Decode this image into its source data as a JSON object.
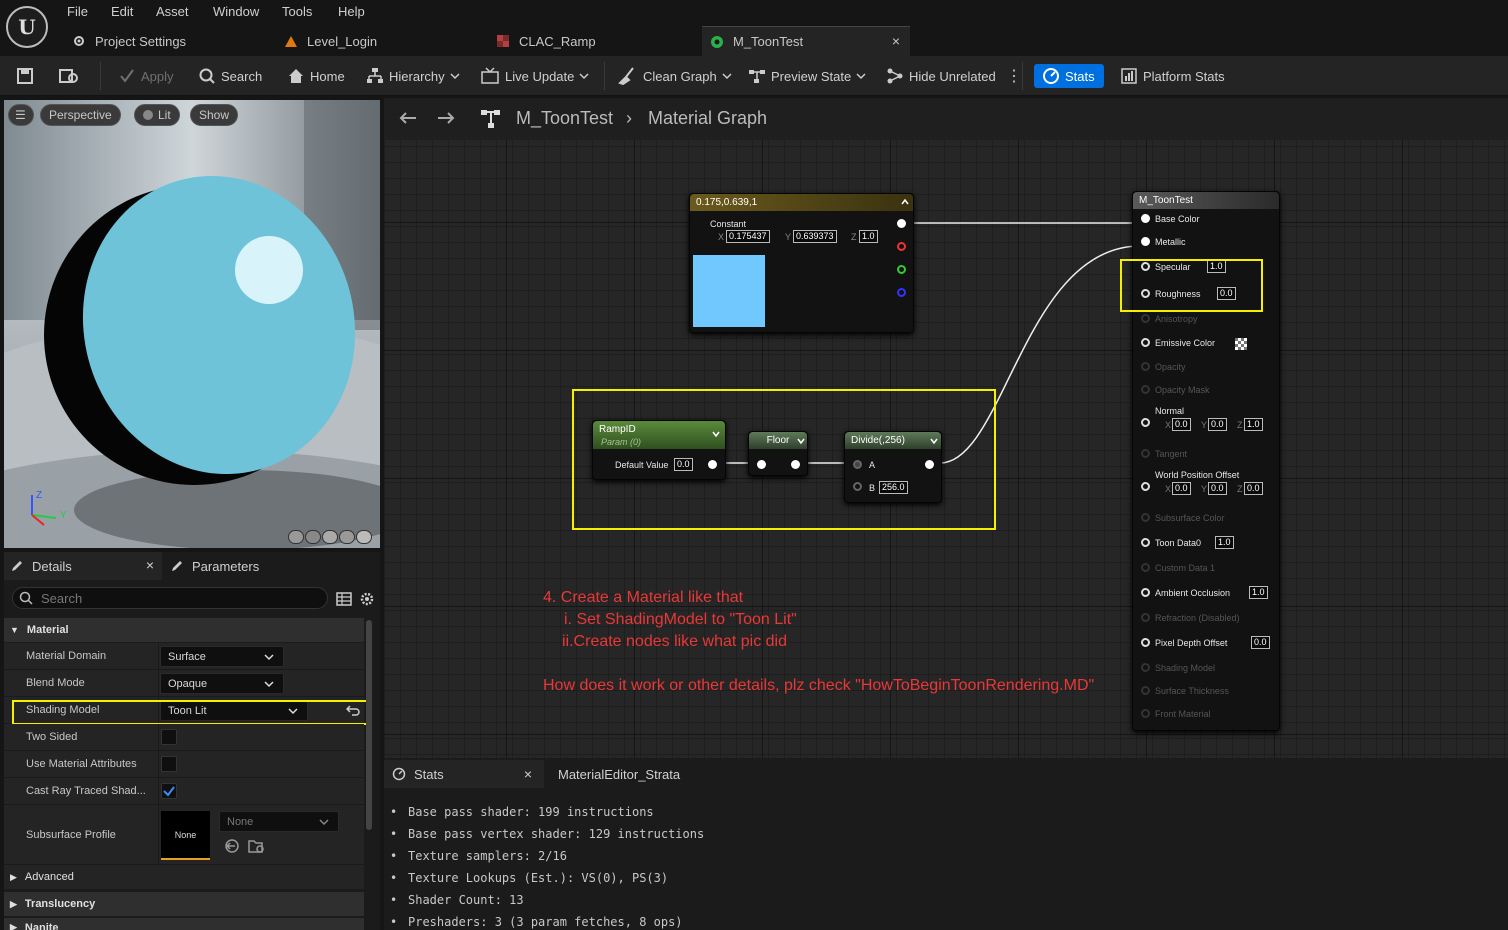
{
  "menu": [
    "File",
    "Edit",
    "Asset",
    "Window",
    "Tools",
    "Help"
  ],
  "tabs": [
    {
      "label": "Project Settings",
      "icon": "gear-icon"
    },
    {
      "label": "Level_Login",
      "icon": "level-icon"
    },
    {
      "label": "CLAC_Ramp",
      "icon": "texture-icon"
    },
    {
      "label": "M_ToonTest",
      "icon": "material-icon",
      "close": "×"
    }
  ],
  "toolbar": {
    "apply": "Apply",
    "search": "Search",
    "home": "Home",
    "hierarchy": "Hierarchy",
    "live_update": "Live Update",
    "clean_graph": "Clean Graph",
    "preview_state": "Preview State",
    "hide_unrelated": "Hide Unrelated",
    "stats": "Stats",
    "platform_stats": "Platform Stats"
  },
  "viewport": {
    "perspective": "Perspective",
    "lit": "Lit",
    "show": "Show",
    "axis_z": "Z",
    "axis_y": "Y"
  },
  "details": {
    "tab_details": "Details",
    "tab_close": "×",
    "tab_parameters": "Parameters",
    "search_placeholder": "Search",
    "cat_material": "Material",
    "rows": [
      {
        "label": "Material Domain",
        "value": "Surface"
      },
      {
        "label": "Blend Mode",
        "value": "Opaque"
      },
      {
        "label": "Shading Model",
        "value": "Toon Lit"
      },
      {
        "label": "Two Sided",
        "checked": false
      },
      {
        "label": "Use Material Attributes",
        "checked": false
      },
      {
        "label": "Cast Ray Traced Shad...",
        "checked": true
      },
      {
        "label": "Subsurface Profile",
        "value": "None",
        "thumb": "None"
      }
    ],
    "cat_advanced": "Advanced",
    "cat_translucency": "Translucency",
    "cat_nanite": "Nanite"
  },
  "graph": {
    "breadcrumb_asset": "M_ToonTest",
    "breadcrumb_page": "Material Graph",
    "const_node": {
      "title": "0.175,0.639,1",
      "label": "Constant",
      "x": "0.175437",
      "y": "0.639373",
      "z": "1.0",
      "color": "#70c8ff"
    },
    "ramp_node": {
      "title": "RampID",
      "subtitle": "Param (0)",
      "default_label": "Default Value",
      "default_value": "0.0"
    },
    "floor_node": {
      "title": "Floor"
    },
    "divide_node": {
      "title": "Divide(,256)",
      "a": "A",
      "b": "B",
      "b_value": "256.0"
    },
    "result_node": {
      "title": "M_ToonTest",
      "pins": [
        {
          "label": "Base Color"
        },
        {
          "label": "Metallic"
        },
        {
          "label": "Specular",
          "value": "1.0"
        },
        {
          "label": "Roughness",
          "value": "0.0"
        },
        {
          "label": "Anisotropy",
          "dim": true
        },
        {
          "label": "Emissive Color"
        },
        {
          "label": "Opacity",
          "dim": true
        },
        {
          "label": "Opacity Mask",
          "dim": true
        },
        {
          "label": "Normal",
          "x": "0.0",
          "y": "0.0",
          "z": "1.0"
        },
        {
          "label": "Tangent",
          "dim": true
        },
        {
          "label": "World Position Offset",
          "x": "0.0",
          "y": "0.0",
          "z": "0.0"
        },
        {
          "label": "Subsurface Color",
          "dim": true
        },
        {
          "label": "Toon Data0",
          "value": "1.0"
        },
        {
          "label": "Custom Data 1",
          "dim": true
        },
        {
          "label": "Ambient Occlusion",
          "value": "1.0"
        },
        {
          "label": "Refraction (Disabled)",
          "dim": true
        },
        {
          "label": "Pixel Depth Offset",
          "value": "0.0"
        },
        {
          "label": "Shading Model",
          "dim": true
        },
        {
          "label": "Surface Thickness",
          "dim": true
        },
        {
          "label": "Front Material",
          "dim": true
        }
      ]
    },
    "annotation": [
      "4. Create a Material like that",
      "i. Set ShadingModel to \"Toon Lit\"",
      "ii.Create nodes like what pic did",
      "How does it work or other details, plz check \"HowToBeginToonRendering.MD\""
    ]
  },
  "stats_panel": {
    "tab_stats": "Stats",
    "tab_close": "×",
    "tab_strata": "MaterialEditor_Strata",
    "lines": [
      "Base pass shader: 199 instructions",
      "Base pass vertex shader: 129 instructions",
      "Texture samplers: 2/16",
      "Texture Lookups (Est.): VS(0), PS(3)",
      "Shader Count: 13",
      "Preshaders: 3  (3 param fetches, 8 ops)"
    ]
  },
  "colors": {
    "accent": "#0070e0",
    "highlight": "#f5f000",
    "annotation": "#e83838",
    "sphere": "#70c8ff"
  }
}
